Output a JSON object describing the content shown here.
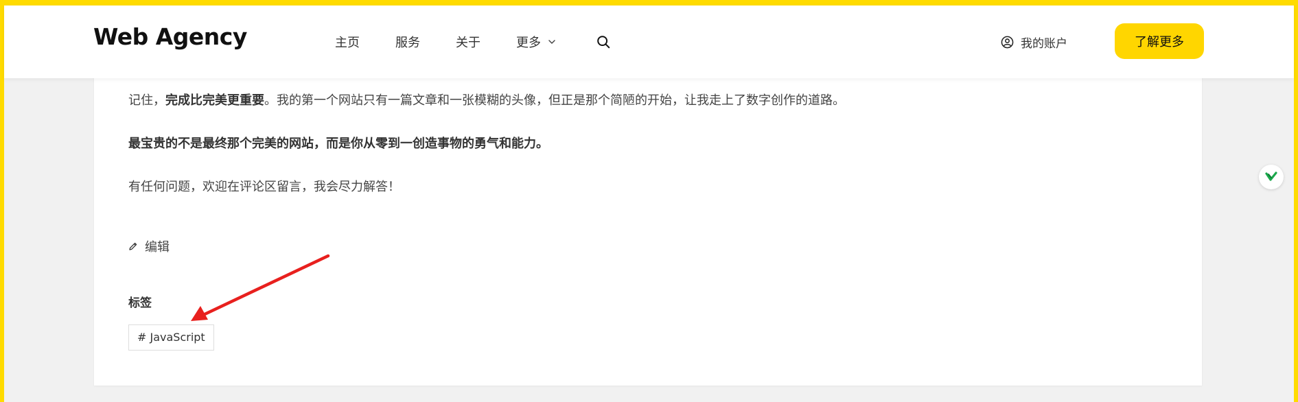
{
  "header": {
    "logo": "Web Agency",
    "nav": [
      {
        "label": "主页"
      },
      {
        "label": "服务"
      },
      {
        "label": "关于"
      },
      {
        "label": "更多"
      }
    ],
    "account_label": "我的账户",
    "cta_label": "了解更多"
  },
  "article": {
    "p1_prefix": "记住，",
    "p1_bold": "完成比完美更重要",
    "p1_suffix": "。我的第一个网站只有一篇文章和一张模糊的头像，但正是那个简陋的开始，让我走上了数字创作的道路。",
    "p2": "最宝贵的不是最终那个完美的网站，而是你从零到一创造事物的勇气和能力。",
    "p3": "有任何问题，欢迎在评论区留言，我会尽力解答！",
    "edit_label": "编辑",
    "tags_label": "标签",
    "tags": [
      "# JavaScript"
    ]
  },
  "colors": {
    "accent": "#ffd600",
    "frame": "#ffdb00",
    "annotation_arrow": "#e8201e",
    "badge_green": "#1aa84b"
  },
  "icons": {
    "search": "search-icon",
    "account": "user-circle-icon",
    "edit": "pencil-icon",
    "more": "chevron-down-icon",
    "side_badge": "checkmark-badge-icon"
  }
}
